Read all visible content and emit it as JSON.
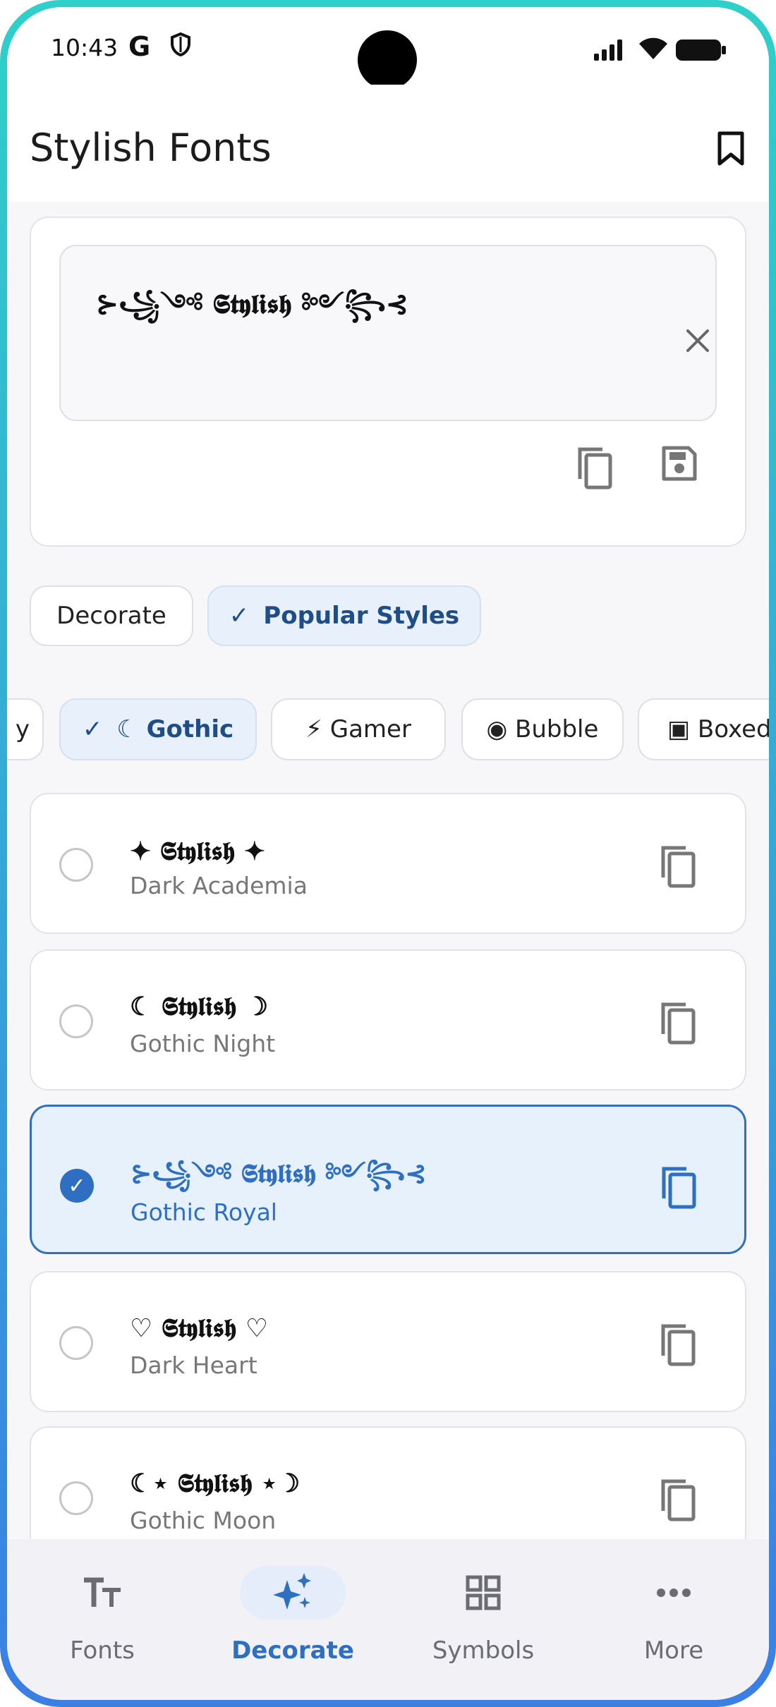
{
  "status": {
    "time": "10:43"
  },
  "app": {
    "title": "Stylish Fonts"
  },
  "editor": {
    "text": "⊱꧁༺ 𝕾𝖙𝖞𝖑𝖎𝖘𝖍 ༻꧂⊰"
  },
  "modes": [
    {
      "label": "Decorate",
      "selected": false
    },
    {
      "label": "Popular Styles",
      "selected": true
    }
  ],
  "categories": [
    {
      "label": "y",
      "selected": false
    },
    {
      "label": "☾ Gothic",
      "selected": true
    },
    {
      "label": "⚡ Gamer",
      "selected": false
    },
    {
      "label": "◉ Bubble",
      "selected": false
    },
    {
      "label": "▣ Boxed",
      "selected": false
    }
  ],
  "styles": [
    {
      "text": "✦ 𝕾𝖙𝖞𝖑𝖎𝖘𝖍 ✦",
      "name": "Dark Academia",
      "selected": false
    },
    {
      "text": "☾ 𝕾𝖙𝖞𝖑𝖎𝖘𝖍 ☽",
      "name": "Gothic Night",
      "selected": false
    },
    {
      "text": "⊱꧁༺ 𝕾𝖙𝖞𝖑𝖎𝖘𝖍 ༻꧂⊰",
      "name": "Gothic Royal",
      "selected": true
    },
    {
      "text": "♡ 𝕾𝖙𝖞𝖑𝖎𝖘𝖍 ♡",
      "name": "Dark Heart",
      "selected": false
    },
    {
      "text": "☾⋆ 𝕾𝖙𝖞𝖑𝖎𝖘𝖍 ⋆☽",
      "name": "Gothic Moon",
      "selected": false
    }
  ],
  "nav": [
    {
      "label": "Fonts",
      "icon": "text-format-icon",
      "active": false
    },
    {
      "label": "Decorate",
      "icon": "sparkle-icon",
      "active": true
    },
    {
      "label": "Symbols",
      "icon": "grid-icon",
      "active": false
    },
    {
      "label": "More",
      "icon": "more-dots-icon",
      "active": false
    }
  ],
  "colors": {
    "accent": "#2f6fc1",
    "selected_bg": "#e7f1fc"
  }
}
